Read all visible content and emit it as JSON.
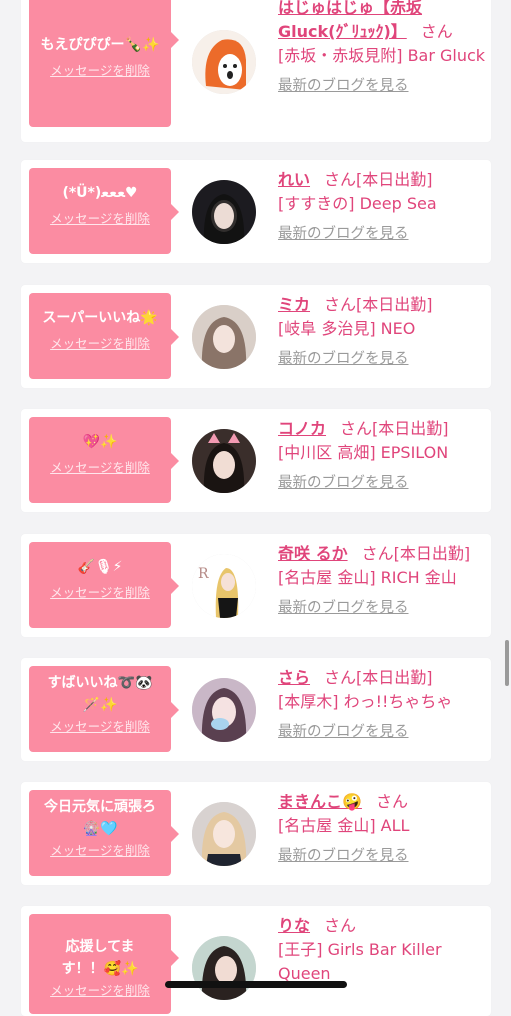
{
  "common": {
    "delete_label": "メッセージを削除",
    "san": "さん",
    "blog_label": "最新のブログを見る"
  },
  "colors": {
    "bubble": "#fb8ca2",
    "accent": "#e0457b",
    "muted": "#9a9a9a",
    "background": "#f3f3f5"
  },
  "cards": [
    {
      "message": "もえぴぴぴー🍾✨",
      "name": "はじゅはじゅ【赤坂Gluck(ｸﾞﾘｭｯｸ)】",
      "status": "",
      "shop": "[赤坂・赤坂見附] Bar Gluck",
      "avatar_icon": "mascot-avatar-icon"
    },
    {
      "message": "(*Ü*)ﻌﻌﻌ♥",
      "name": "れい",
      "status": "[本日出勤]",
      "shop": "[すすきの] Deep Sea",
      "avatar_icon": "profile-photo-icon"
    },
    {
      "message": "スーパーいいね🌟",
      "name": "ミカ",
      "status": "[本日出勤]",
      "shop": "[岐阜 多治見] NEO",
      "avatar_icon": "profile-photo-icon"
    },
    {
      "message": "💖✨",
      "name": "コノカ",
      "status": "[本日出勤]",
      "shop": "[中川区 高畑] EPSILON",
      "avatar_icon": "profile-photo-icon"
    },
    {
      "message": "🎸🎙⚡",
      "name": "奇咲 るか",
      "status": "[本日出勤]",
      "shop": "[名古屋 金山] RICH 金山",
      "avatar_icon": "profile-photo-icon"
    },
    {
      "message": "すばいいね➰🐼🪄✨",
      "name": "さら",
      "status": "[本日出勤]",
      "shop": "[本厚木] わっ!!ちゃちゃ",
      "avatar_icon": "profile-photo-icon"
    },
    {
      "message": "今日元気に頑張ろ🎡🩵",
      "name": "まきんこ🤪",
      "status": "",
      "shop": "[名古屋 金山] ALL",
      "avatar_icon": "profile-photo-icon"
    },
    {
      "message": "応援してます！！🥰✨",
      "name": "りな",
      "status": "",
      "shop": "[王子] Girls Bar Killer Queen",
      "avatar_icon": "profile-photo-icon"
    }
  ]
}
